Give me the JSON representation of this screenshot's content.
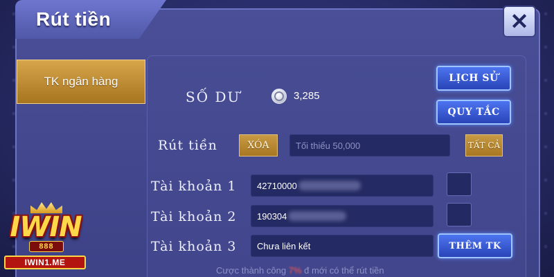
{
  "dialog": {
    "title": "Rút tiền",
    "close_glyph": "✕",
    "close_icon": "close-icon"
  },
  "sidebar": {
    "items": [
      {
        "label": "TK ngân hàng",
        "active": true
      }
    ]
  },
  "balance": {
    "label": "SỐ DƯ",
    "icon": "coin-icon",
    "value": "3,285"
  },
  "actions": {
    "history_label": "LỊCH SỬ",
    "rules_label": "QUY TẮC",
    "add_account_label": "THÊM TK"
  },
  "withdraw": {
    "label": "Rút tiền",
    "clear_label": "XÓA",
    "amount_placeholder": "Tối thiểu 50,000",
    "all_label": "TẤT CẢ"
  },
  "accounts": [
    {
      "label": "Tài khoản 1",
      "value": "42710000",
      "checked": false
    },
    {
      "label": "Tài khoản 2",
      "value": "190304",
      "checked": false
    },
    {
      "label": "Tài khoản 3",
      "value": "Chưa liên kết"
    }
  ],
  "notice": {
    "prefix": "Cược thành công",
    "amount": "7%",
    "suffix": "đ mới có thể rút tiền"
  },
  "logo": {
    "main": "IWIN",
    "badge": "888",
    "url": "IWIN1.ME"
  },
  "colors": {
    "accent_blue": "#2944b7",
    "accent_gold": "#c89a43",
    "highlight_red": "#ff5a4a",
    "panel_bg": "#42468c"
  }
}
